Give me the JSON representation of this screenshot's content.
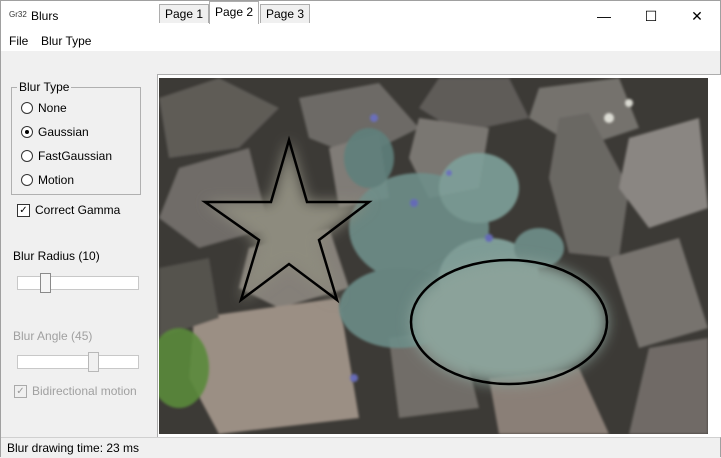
{
  "window": {
    "icon_text": "Gr32",
    "title": "Blurs",
    "minimize_glyph": "—",
    "maximize_glyph": "☐",
    "close_glyph": "✕"
  },
  "menu": {
    "file": "File",
    "blur_type": "Blur Type"
  },
  "blur_type_group": {
    "legend": "Blur Type",
    "options": [
      {
        "label": "None",
        "checked": false
      },
      {
        "label": "Gaussian",
        "checked": true
      },
      {
        "label": "FastGaussian",
        "checked": false
      },
      {
        "label": "Motion",
        "checked": false
      }
    ]
  },
  "correct_gamma": {
    "label": "Correct Gamma",
    "checked": true
  },
  "blur_radius": {
    "label": "Blur Radius (10)",
    "value": 10
  },
  "blur_angle": {
    "label": "Blur Angle (45)",
    "value": 45,
    "enabled": false
  },
  "bidirectional": {
    "label": "Bidirectional motion",
    "checked": true,
    "enabled": false
  },
  "tabs": [
    {
      "label": "Page 1",
      "active": false
    },
    {
      "label": "Page 2",
      "active": true
    },
    {
      "label": "Page 3",
      "active": false
    }
  ],
  "status": {
    "text": "Blur drawing time: 23 ms"
  }
}
